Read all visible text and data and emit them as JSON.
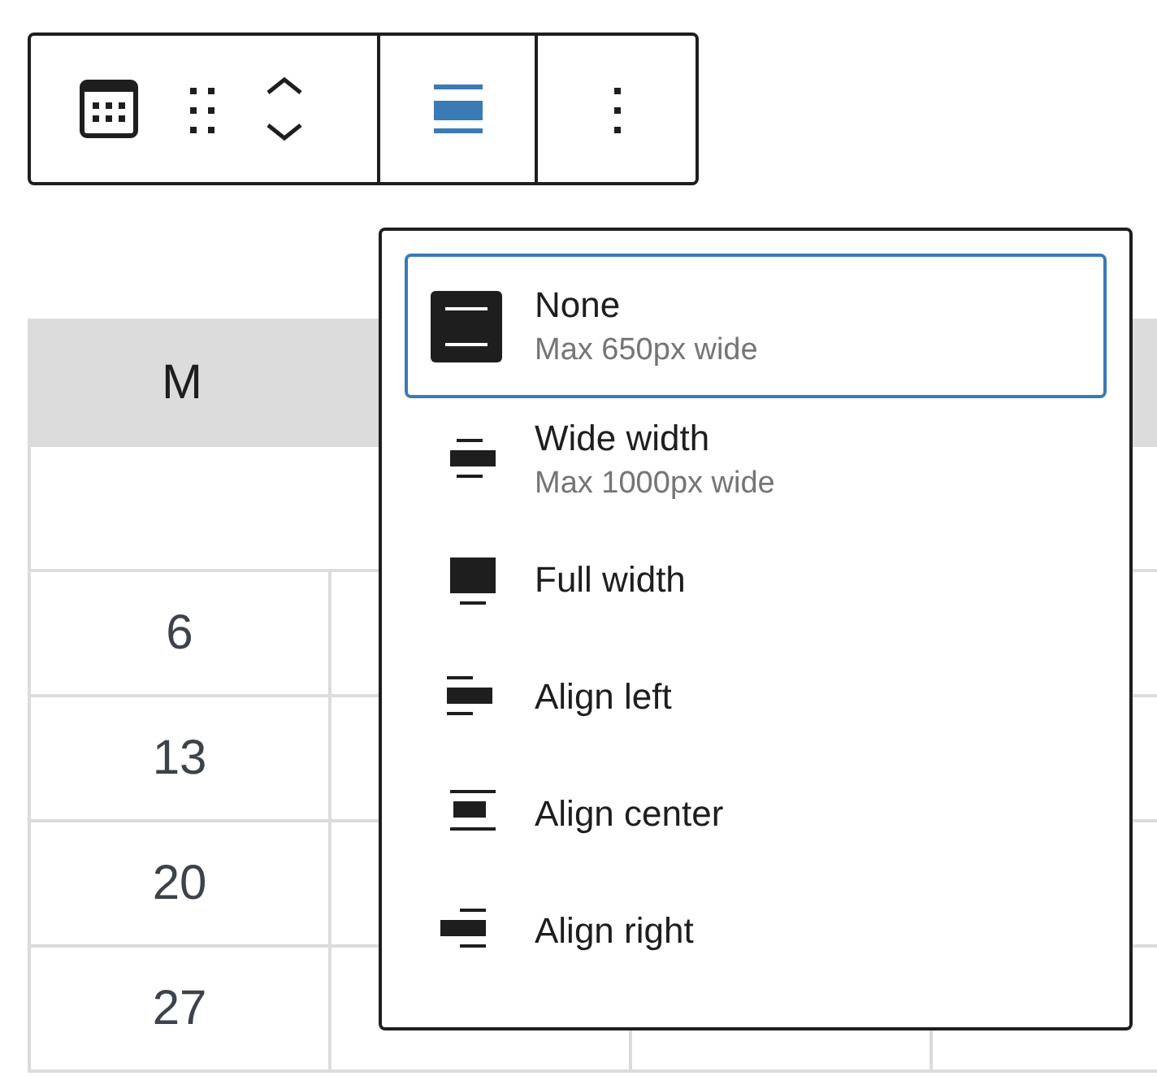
{
  "toolbar": {
    "tools": [
      {
        "kind": "block-type"
      },
      {
        "kind": "drag"
      },
      {
        "kind": "move"
      }
    ],
    "align_button": {
      "expanded": true
    },
    "more_button": {
      "kind": "more"
    }
  },
  "calendar": {
    "header": "M",
    "days": [
      "6",
      "13",
      "20",
      "27"
    ]
  },
  "align_menu": {
    "items": [
      {
        "kind": "none",
        "label": "None",
        "description": "Max 650px wide",
        "selected": true
      },
      {
        "kind": "wide",
        "label": "Wide width",
        "description": "Max 1000px wide",
        "selected": false
      },
      {
        "kind": "full",
        "label": "Full width",
        "selected": false
      },
      {
        "kind": "left",
        "label": "Align left",
        "selected": false
      },
      {
        "kind": "center",
        "label": "Align center",
        "selected": false
      },
      {
        "kind": "right",
        "label": "Align right",
        "selected": false
      }
    ]
  }
}
